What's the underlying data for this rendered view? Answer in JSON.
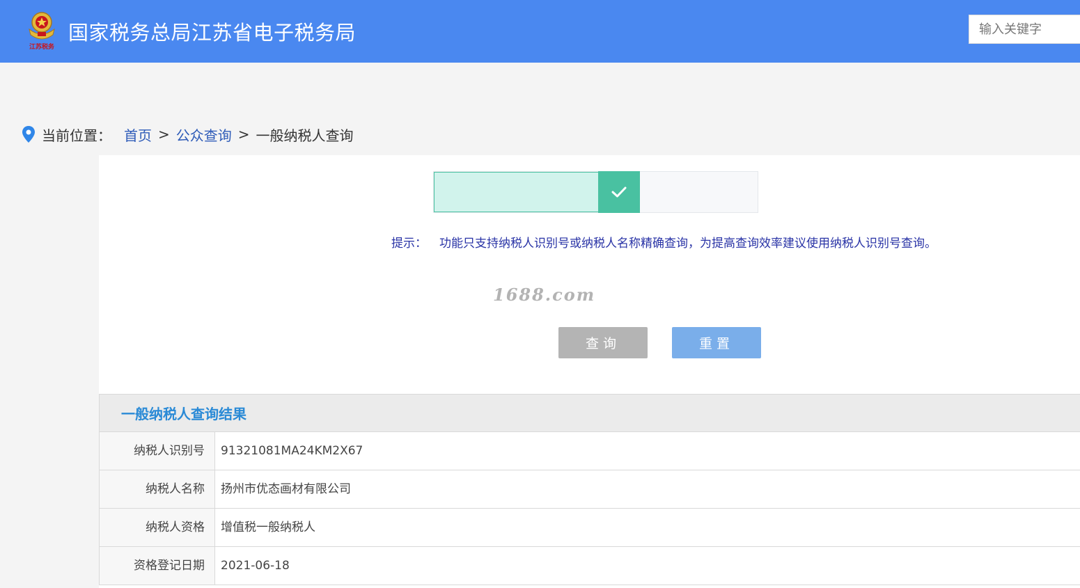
{
  "header": {
    "emblem_text": "江苏税务",
    "title": "国家税务总局江苏省电子税务局",
    "search_placeholder": "输入关键字",
    "brand_color": "#4a88f0"
  },
  "breadcrumb": {
    "label": "当前位置：",
    "items": [
      "首页",
      "公众查询",
      "一般纳税人查询"
    ],
    "separator": ">"
  },
  "verify_slider": {
    "status": "verified",
    "fill_fraction": 0.63,
    "accent_color": "#49c1a1"
  },
  "tip": {
    "label": "提示：",
    "text": "功能只支持纳税人识别号或纳税人名称精确查询，为提高查询效率建议使用纳税人识别号查询。"
  },
  "watermark": "1688.com",
  "buttons": {
    "query": "查询",
    "reset": "重置"
  },
  "result": {
    "title": "一般纳税人查询结果",
    "rows": [
      {
        "label": "纳税人识别号",
        "value": "91321081MA24KM2X67"
      },
      {
        "label": "纳税人名称",
        "value": "扬州市优态画材有限公司"
      },
      {
        "label": "纳税人资格",
        "value": "增值税一般纳税人"
      },
      {
        "label": "资格登记日期",
        "value": "2021-06-18"
      }
    ]
  }
}
